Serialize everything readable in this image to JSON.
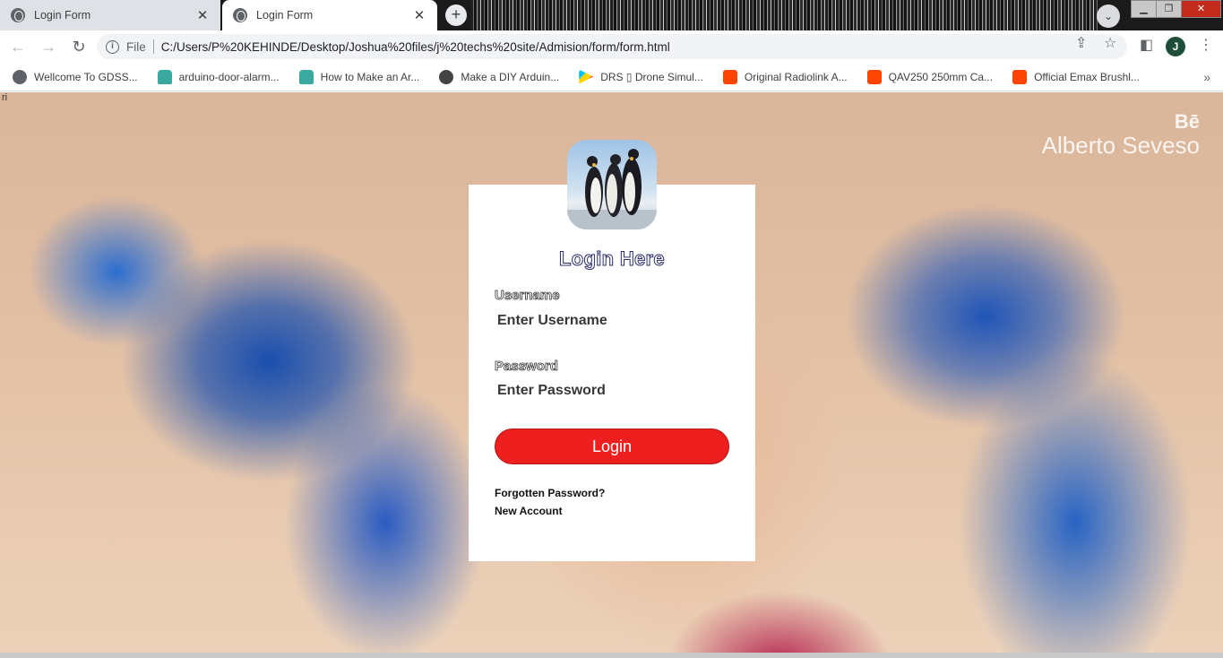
{
  "browser": {
    "tabs": [
      {
        "title": "Login Form",
        "active": false
      },
      {
        "title": "Login Form",
        "active": true
      }
    ],
    "address": {
      "scheme": "File",
      "url": "C:/Users/P%20KEHINDE/Desktop/Joshua%20files/j%20techs%20site/Admision/form/form.html"
    },
    "profile_initial": "J",
    "bookmarks": [
      {
        "label": "Wellcome To GDSS...",
        "icon": "globe-icon"
      },
      {
        "label": "arduino-door-alarm...",
        "icon": "robot-icon"
      },
      {
        "label": "How to Make an Ar...",
        "icon": "robot-icon"
      },
      {
        "label": "Make a DIY Arduin...",
        "icon": "site-icon"
      },
      {
        "label": "DRS ▯ Drone Simul...",
        "icon": "play-store-icon"
      },
      {
        "label": "Original Radiolink A...",
        "icon": "aliexpress-icon"
      },
      {
        "label": "QAV250 250mm Ca...",
        "icon": "aliexpress-icon"
      },
      {
        "label": "Official Emax Brushl...",
        "icon": "aliexpress-icon"
      }
    ]
  },
  "page": {
    "stray_text": "ri",
    "watermark": {
      "brand": "Bē",
      "artist": "Alberto Seveso"
    },
    "form": {
      "title": "Login Here",
      "username_label": "Username",
      "username_placeholder": "Enter Username",
      "password_label": "Password",
      "password_placeholder": "Enter Password",
      "login_button": "Login",
      "forgot_link": "Forgotten Password?",
      "new_account_link": "New Account"
    }
  },
  "colors": {
    "login_button": "#ef1f1f",
    "card_background": "#ffffff"
  }
}
